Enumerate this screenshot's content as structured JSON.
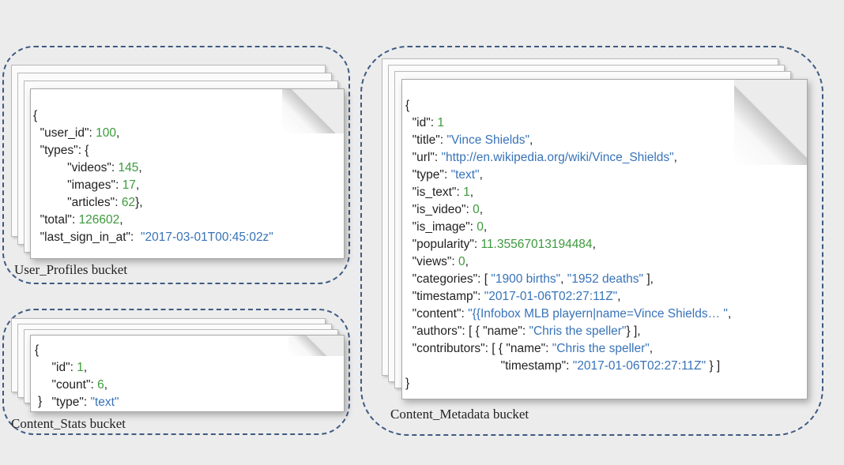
{
  "user_profiles": {
    "label": "User_Profiles bucket",
    "doc": {
      "open_brace": "{",
      "user_id_key": "\"user_id\"",
      "user_id_val": "100",
      "types_key": "\"types\"",
      "videos_key": "\"videos\"",
      "videos_val": "145",
      "images_key": "\"images\"",
      "images_val": "17",
      "articles_key": "\"articles\"",
      "articles_val": "62",
      "total_key": "\"total\"",
      "total_val": "126602",
      "last_sign_key": "\"last_sign_in_at\"",
      "last_sign_val": "\"2017-03-01T00:45:02z\""
    }
  },
  "content_stats": {
    "label": "Content_Stats bucket",
    "doc": {
      "open_brace": "{",
      "close_brace": "}",
      "id_key": "\"id\"",
      "id_val": "1",
      "count_key": "\"count\"",
      "count_val": "6",
      "type_key": "\"type\"",
      "type_val": "\"text\""
    }
  },
  "content_metadata": {
    "label": "Content_Metadata bucket",
    "doc": {
      "open_brace": "{",
      "close_brace": "}",
      "id_key": "\"id\"",
      "id_val": "1",
      "title_key": "\"title\"",
      "title_val": "\"Vince Shields\"",
      "url_key": "\"url\"",
      "url_val": "\"http://en.wikipedia.org/wiki/Vince_Shields\"",
      "type_key": "\"type\"",
      "type_val": "\"text\"",
      "is_text_key": "\"is_text\"",
      "is_text_val": "1",
      "is_video_key": "\"is_video\"",
      "is_video_val": "0",
      "is_image_key": "\"is_image\"",
      "is_image_val": "0",
      "popularity_key": "\"popularity\"",
      "popularity_val": "11.35567013194484",
      "views_key": "\"views\"",
      "views_val": "0",
      "categories_key": "\"categories\"",
      "categories_val1": "\"1900 births\"",
      "categories_val2": "\"1952 deaths\"",
      "timestamp_key": "\"timestamp\"",
      "timestamp_val": "\"2017-01-06T02:27:11Z\"",
      "content_key": "\"content\"",
      "content_val": "\"{{Infobox MLB playern|name=Vince Shields… \"",
      "authors_key": "\"authors\"",
      "authors_name_key": "\"name\"",
      "authors_name_val": "\"Chris the speller\"",
      "contributors_key": "\"contributors\"",
      "contributors_name_key": "\"name\"",
      "contributors_name_val": "\"Chris the speller\"",
      "contributors_ts_key": "\"timestamp\"",
      "contributors_ts_val": "\"2017-01-06T02:27:11Z\""
    }
  },
  "colors": {
    "key": "#222222",
    "number": "#3c9a3c",
    "string": "#3873b8",
    "bucket_border": "#3e5a82"
  }
}
